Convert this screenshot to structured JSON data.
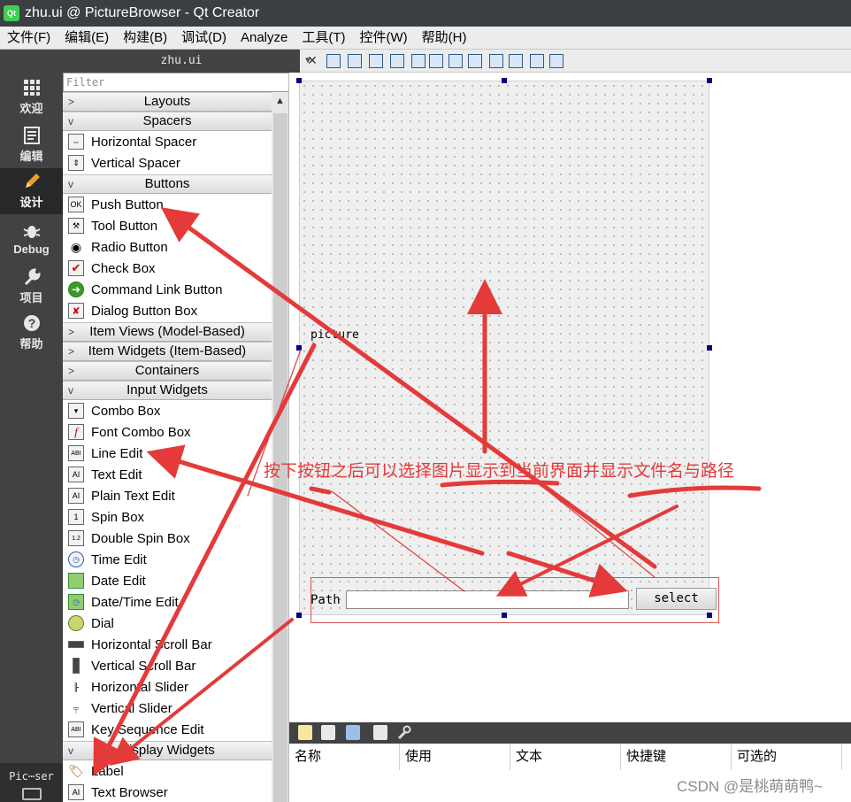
{
  "window": {
    "title": "zhu.ui @ PictureBrowser - Qt Creator",
    "logo_text": "Qt"
  },
  "menu": [
    "文件(F)",
    "编辑(E)",
    "构建(B)",
    "调试(D)",
    "Analyze",
    "工具(T)",
    "控件(W)",
    "帮助(H)"
  ],
  "modes": [
    {
      "label": "欢迎",
      "icon": "grid-icon"
    },
    {
      "label": "编辑",
      "icon": "document-icon"
    },
    {
      "label": "设计",
      "icon": "pencil-icon"
    },
    {
      "label": "Debug",
      "icon": "bug-icon"
    },
    {
      "label": "项目",
      "icon": "wrench-icon"
    },
    {
      "label": "帮助",
      "icon": "help-icon"
    }
  ],
  "active_mode": "设计",
  "target_selector": "Pic⋯ser",
  "editor": {
    "file_tab": "zhu.ui"
  },
  "widget_box": {
    "filter_placeholder": "Filter",
    "categories": {
      "layouts": "Layouts",
      "spacers": "Spacers",
      "buttons": "Buttons",
      "item_views": "Item Views (Model-Based)",
      "item_widgets": "Item Widgets (Item-Based)",
      "containers": "Containers",
      "input_widgets": "Input Widgets",
      "display_widgets": "Display Widgets"
    },
    "spacers": [
      "Horizontal Spacer",
      "Vertical Spacer"
    ],
    "buttons": [
      "Push Button",
      "Tool Button",
      "Radio Button",
      "Check Box",
      "Command Link Button",
      "Dialog Button Box"
    ],
    "input_widgets": [
      "Combo Box",
      "Font Combo Box",
      "Line Edit",
      "Text Edit",
      "Plain Text Edit",
      "Spin Box",
      "Double Spin Box",
      "Time Edit",
      "Date Edit",
      "Date/Time Edit",
      "Dial",
      "Horizontal Scroll Bar",
      "Vertical Scroll Bar",
      "Horizontal Slider",
      "Vertical Slider",
      "Key Sequence Edit"
    ],
    "display_widgets": [
      "Label",
      "Text Browser"
    ]
  },
  "form": {
    "picture_label": "picture",
    "path_label": "Path",
    "path_value": "",
    "select_button": "select"
  },
  "action_editor": {
    "columns": [
      "名称",
      "使用",
      "文本",
      "快捷键",
      "可选的"
    ]
  },
  "annotation": "按下按钮之后可以选择图片显示到当前界面并显示文件名与路径",
  "watermark": "CSDN @是桃萌萌鸭~",
  "colors": {
    "annotation": "#e43a3a",
    "mode_bar": "#404244",
    "handle": "#000080"
  }
}
